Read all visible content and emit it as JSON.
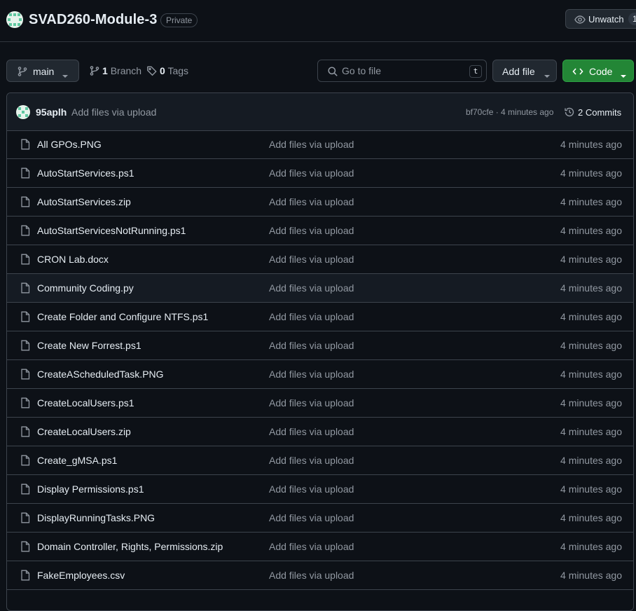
{
  "repo": {
    "name": "SVAD260-Module-3",
    "visibility": "Private",
    "watch": {
      "label": "Unwatch",
      "count": "1",
      "icon": "eye-icon"
    }
  },
  "toolbar": {
    "branch": {
      "label": "main",
      "icon": "git-branch-icon"
    },
    "branches": {
      "count": "1",
      "label": "Branch"
    },
    "tags": {
      "count": "0",
      "label": "Tags"
    },
    "search": {
      "placeholder": "Go to file",
      "shortcut": "t"
    },
    "add_file_label": "Add file",
    "code_label": "Code"
  },
  "colors": {
    "accent_green": "#238636",
    "background": "#0d1117",
    "border": "#3d444d"
  },
  "latest_commit": {
    "author": "95aplh",
    "message": "Add files via upload",
    "hash_time": "bf70cfe · 4 minutes ago",
    "commits_label": "2 Commits"
  },
  "files": [
    {
      "name": "All GPOs.PNG",
      "message": "Add files via upload",
      "time": "4 minutes ago"
    },
    {
      "name": "AutoStartServices.ps1",
      "message": "Add files via upload",
      "time": "4 minutes ago"
    },
    {
      "name": "AutoStartServices.zip",
      "message": "Add files via upload",
      "time": "4 minutes ago"
    },
    {
      "name": "AutoStartServicesNotRunning.ps1",
      "message": "Add files via upload",
      "time": "4 minutes ago"
    },
    {
      "name": "CRON Lab.docx",
      "message": "Add files via upload",
      "time": "4 minutes ago"
    },
    {
      "name": "Community Coding.py",
      "message": "Add files via upload",
      "time": "4 minutes ago"
    },
    {
      "name": "Create Folder and Configure NTFS.ps1",
      "message": "Add files via upload",
      "time": "4 minutes ago"
    },
    {
      "name": "Create New Forrest.ps1",
      "message": "Add files via upload",
      "time": "4 minutes ago"
    },
    {
      "name": "CreateAScheduledTask.PNG",
      "message": "Add files via upload",
      "time": "4 minutes ago"
    },
    {
      "name": "CreateLocalUsers.ps1",
      "message": "Add files via upload",
      "time": "4 minutes ago"
    },
    {
      "name": "CreateLocalUsers.zip",
      "message": "Add files via upload",
      "time": "4 minutes ago"
    },
    {
      "name": "Create_gMSA.ps1",
      "message": "Add files via upload",
      "time": "4 minutes ago"
    },
    {
      "name": "Display Permissions.ps1",
      "message": "Add files via upload",
      "time": "4 minutes ago"
    },
    {
      "name": "DisplayRunningTasks.PNG",
      "message": "Add files via upload",
      "time": "4 minutes ago"
    },
    {
      "name": "Domain Controller, Rights, Permissions.zip",
      "message": "Add files via upload",
      "time": "4 minutes ago"
    },
    {
      "name": "FakeEmployees.csv",
      "message": "Add files via upload",
      "time": "4 minutes ago"
    }
  ]
}
